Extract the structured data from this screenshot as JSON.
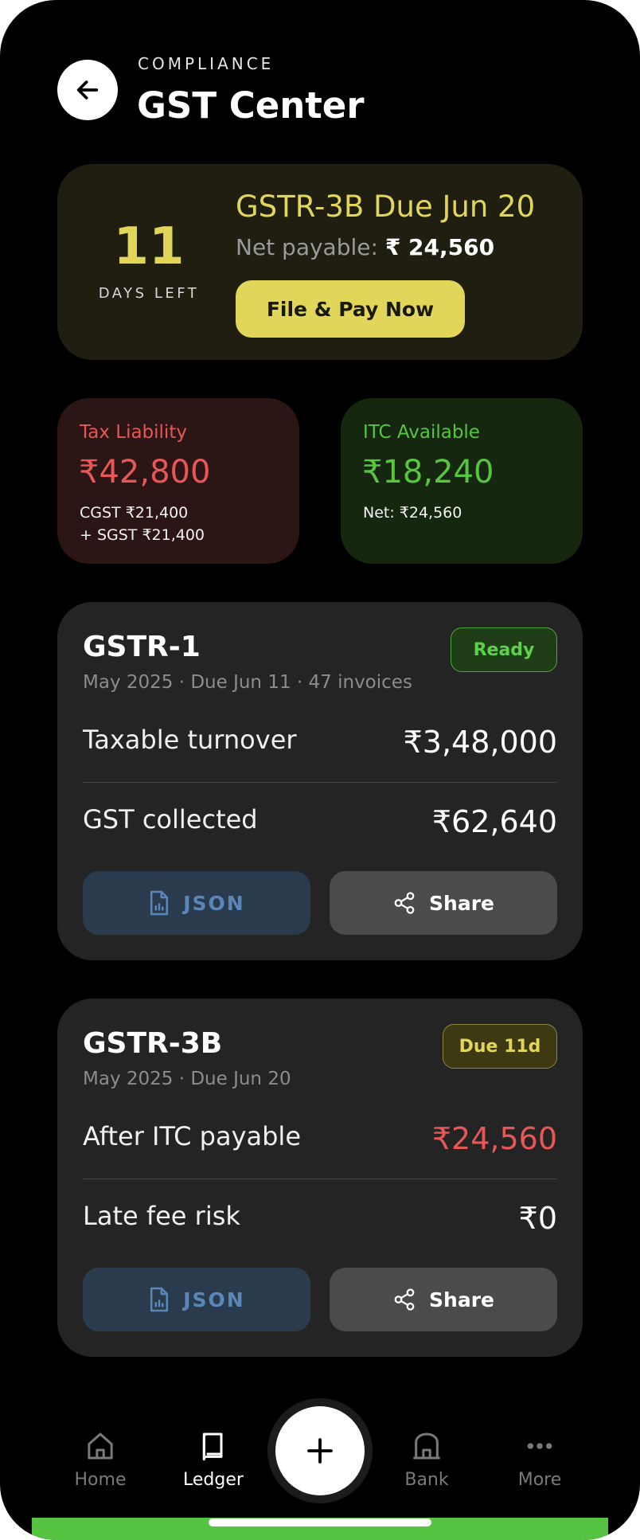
{
  "header": {
    "eyebrow": "COMPLIANCE",
    "title": "GST Center"
  },
  "due_card": {
    "days": "11",
    "days_label": "DAYS LEFT",
    "title": "GSTR-3B Due Jun 20",
    "net_label": "Net payable: ",
    "net_amount": "₹ 24,560",
    "button": "File & Pay Now"
  },
  "stats": {
    "liability": {
      "label": "Tax Liability",
      "value": "₹42,800",
      "line1": "CGST ₹21,400",
      "line2": "+ SGST ₹21,400"
    },
    "itc": {
      "label": "ITC Available",
      "value": "₹18,240",
      "line1": "Net: ₹24,560"
    }
  },
  "returns": [
    {
      "title": "GSTR-1",
      "subtitle": "May 2025 · Due Jun 11 · 47 invoices",
      "badge": "Ready",
      "rows": [
        {
          "label": "Taxable turnover",
          "value": "₹3,48,000"
        },
        {
          "label": "GST collected",
          "value": "₹62,640"
        }
      ],
      "json_label": "JSON",
      "share_label": "Share"
    },
    {
      "title": "GSTR-3B",
      "subtitle": "May 2025 · Due Jun 20",
      "badge": "Due 11d",
      "rows": [
        {
          "label": "After ITC payable",
          "value": "₹24,560"
        },
        {
          "label": "Late fee risk",
          "value": "₹0"
        }
      ],
      "json_label": "JSON",
      "share_label": "Share"
    }
  ],
  "nav": {
    "home": "Home",
    "ledger": "Ledger",
    "bank": "Bank",
    "more": "More"
  },
  "icons": {
    "back": "arrow-left-icon",
    "json": "file-chart-icon",
    "share": "share-icon",
    "home": "home-icon",
    "ledger": "book-icon",
    "add": "plus-icon",
    "bank": "bank-icon",
    "more": "dots-icon"
  },
  "colors": {
    "accent_yellow": "#e1d65a",
    "liability_red": "#e85757",
    "itc_green": "#57c63f",
    "nav_bar_green": "#56c342"
  }
}
